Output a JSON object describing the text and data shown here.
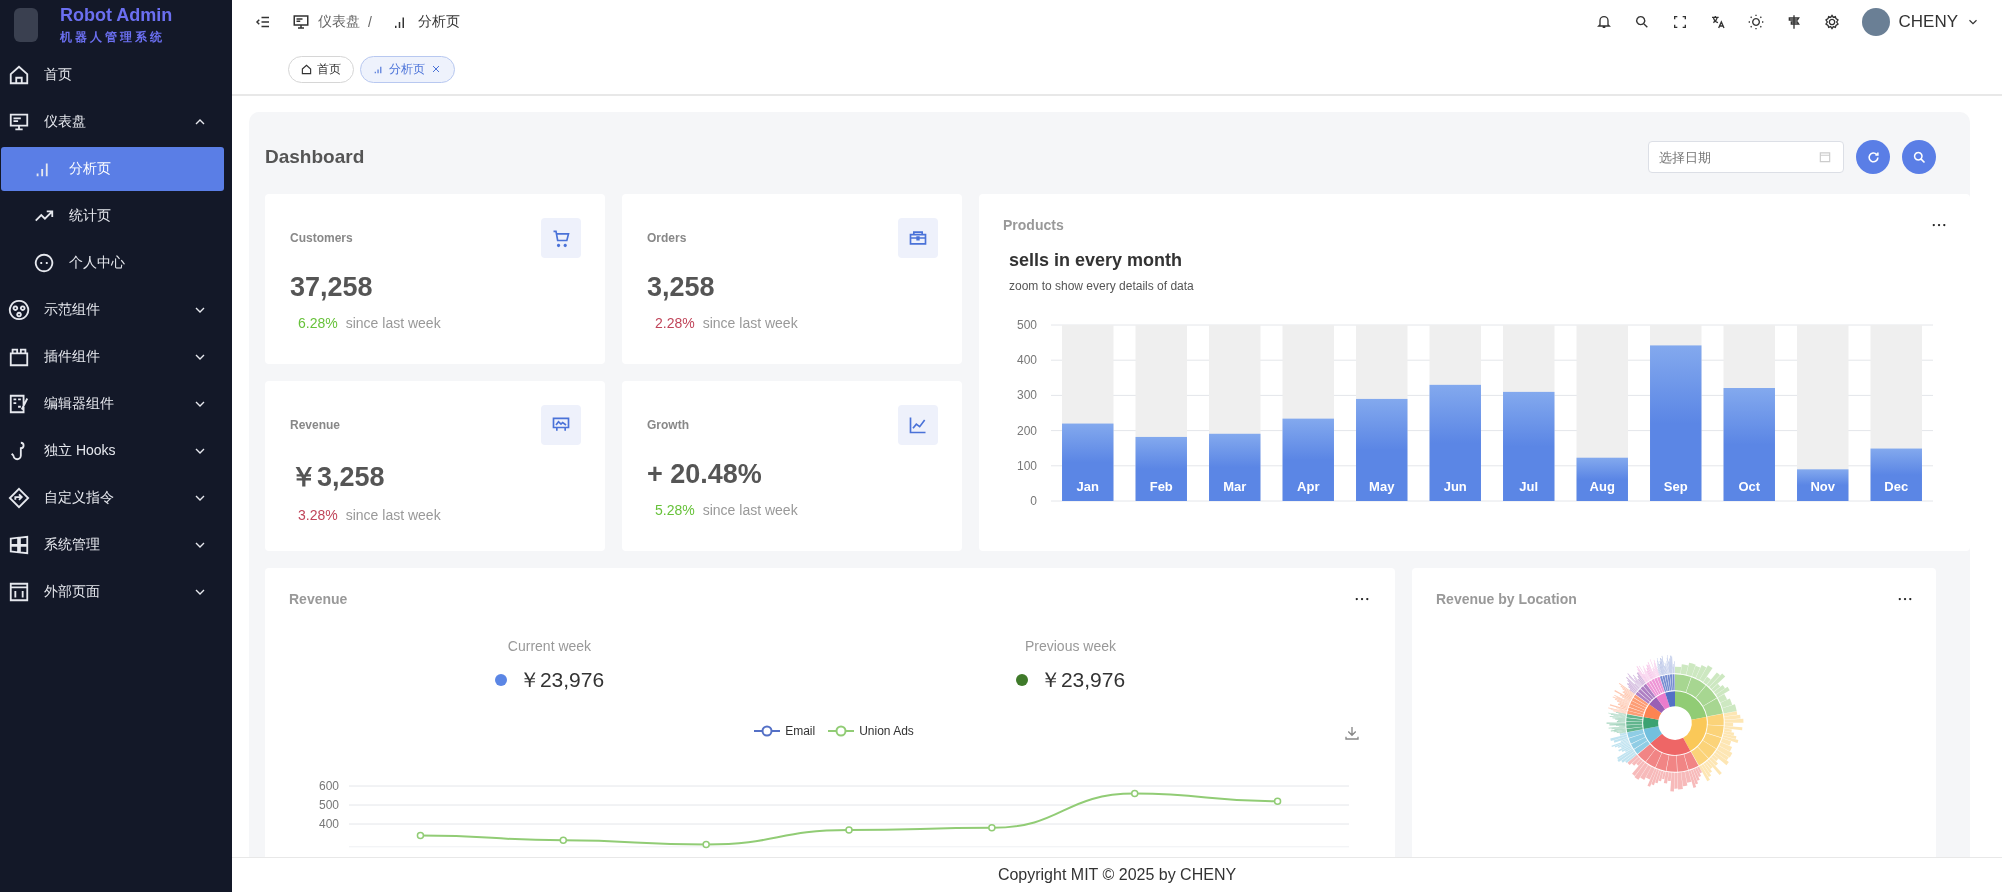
{
  "brand": {
    "title": "Robot Admin",
    "subtitle": "机器人管理系统"
  },
  "sidebar": {
    "items": [
      {
        "label": "首页",
        "selected": false
      },
      {
        "label": "仪表盘",
        "selected": false,
        "expanded": true,
        "children": [
          {
            "label": "分析页",
            "selected": true
          },
          {
            "label": "统计页",
            "selected": false
          },
          {
            "label": "个人中心",
            "selected": false
          }
        ]
      },
      {
        "label": "示范组件",
        "selected": false,
        "expanded": false
      },
      {
        "label": "插件组件",
        "selected": false,
        "expanded": false
      },
      {
        "label": "编辑器组件",
        "selected": false,
        "expanded": false
      },
      {
        "label": "独立 Hooks",
        "selected": false,
        "expanded": false
      },
      {
        "label": "自定义指令",
        "selected": false,
        "expanded": false
      },
      {
        "label": "系统管理",
        "selected": false,
        "expanded": false
      },
      {
        "label": "外部页面",
        "selected": false,
        "expanded": false
      }
    ]
  },
  "breadcrumb": [
    "仪表盘",
    "/",
    "分析页"
  ],
  "user": {
    "name": "CHENY"
  },
  "tabs": [
    {
      "label": "首页",
      "selected": false,
      "closable": false
    },
    {
      "label": "分析页",
      "selected": true,
      "closable": true
    }
  ],
  "dashboard": {
    "title": "Dashboard",
    "date_field": {
      "placeholder": "选择日期"
    }
  },
  "stats": [
    {
      "title": "Customers",
      "value": "37,258",
      "change": "6.28%",
      "color": "#67c23a",
      "note": "since last week"
    },
    {
      "title": "Orders",
      "value": "3,258",
      "change": "2.28%",
      "color": "#c0455a",
      "note": "since last week"
    },
    {
      "title": "Revenue",
      "value": "￥3,258",
      "change": "3.28%",
      "color": "#c0455a",
      "note": "since last week"
    },
    {
      "title": "Growth",
      "value": "+ 20.48%",
      "change": "5.28%",
      "color": "#67c23a",
      "note": "since last week"
    }
  ],
  "products": {
    "title": "Products",
    "chart_data": {
      "type": "bar",
      "title": "sells in every month",
      "subtitle": "zoom to show every details of data",
      "categories": [
        "Jan",
        "Feb",
        "Mar",
        "Apr",
        "May",
        "Jun",
        "Jul",
        "Aug",
        "Sep",
        "Oct",
        "Nov",
        "Dec"
      ],
      "values": [
        220,
        182,
        191,
        234,
        290,
        330,
        310,
        123,
        442,
        321,
        90,
        149
      ],
      "ylim": [
        0,
        500
      ],
      "yticks": [
        0,
        100,
        200,
        300,
        400,
        500
      ],
      "grid": true
    }
  },
  "revenue": {
    "title": "Revenue",
    "summary": [
      {
        "label": "Current week",
        "value": "￥23,976",
        "color": "#5b86e5"
      },
      {
        "label": "Previous week",
        "value": "￥23,976",
        "color": "#3f7a2a"
      }
    ],
    "chart_data": {
      "type": "line",
      "ylim": [
        280,
        600
      ],
      "yticks": [
        400,
        500,
        600
      ],
      "grid": true,
      "series": [
        {
          "name": "Email",
          "color": "#5470c6",
          "values": [
            null,
            null,
            null,
            null,
            null,
            null,
            null
          ]
        },
        {
          "name": "Union Ads",
          "color": "#91cc75",
          "marker": true,
          "values": [
            340,
            314,
            292,
            368,
            380,
            560,
            520
          ]
        }
      ]
    }
  },
  "location": {
    "title": "Revenue by Location"
  },
  "footer": "Copyright MIT © 2025 by CHENY"
}
